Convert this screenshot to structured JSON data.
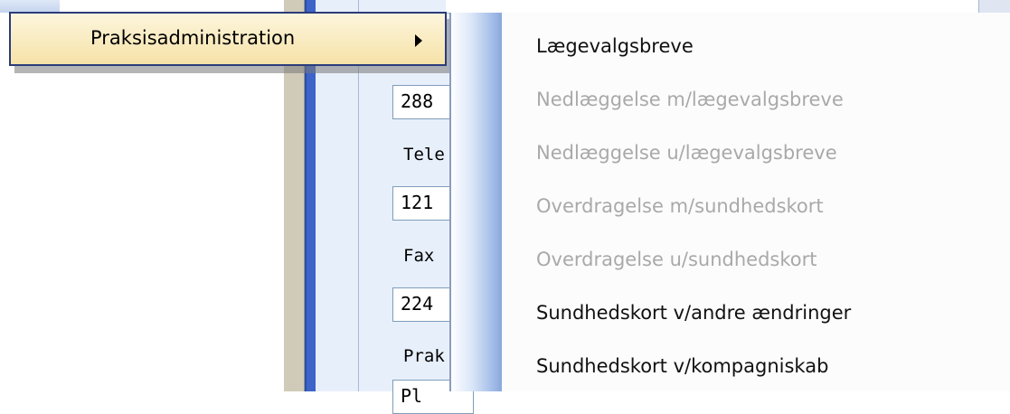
{
  "background_form": {
    "labels": [
      "Tele",
      "Fax",
      "Prak"
    ],
    "fields": [
      "288",
      "121",
      "224",
      "Pl"
    ]
  },
  "menu": {
    "item_label": "Praksisadministration",
    "submenu_icon": "chevron-right-icon"
  },
  "submenu": {
    "items": [
      {
        "label": "Lægevalgsbreve",
        "enabled": true
      },
      {
        "label": "Nedlæggelse m/lægevalgsbreve",
        "enabled": false
      },
      {
        "label": "Nedlæggelse u/lægevalgsbreve",
        "enabled": false
      },
      {
        "label": "Overdragelse m/sundhedskort",
        "enabled": false
      },
      {
        "label": "Overdragelse u/sundhedskort",
        "enabled": false
      },
      {
        "label": "Sundhedskort v/andre ændringer",
        "enabled": true
      },
      {
        "label": "Sundhedskort v/kompagniskab",
        "enabled": true
      }
    ]
  },
  "colors": {
    "menu_highlight": "#f6e2a8",
    "menu_border": "#2a3c7a",
    "disabled_text": "#a9a9a9",
    "rail_blue": "#3d64c8"
  }
}
